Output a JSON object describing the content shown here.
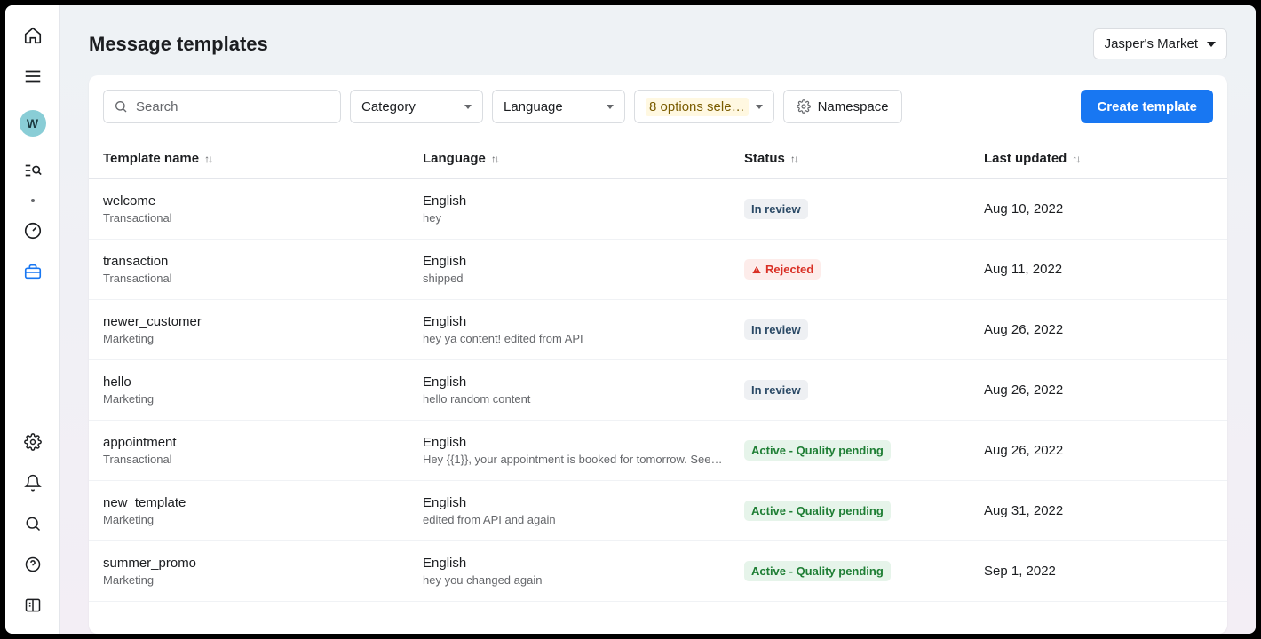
{
  "header": {
    "title": "Message templates",
    "account": "Jasper's Market"
  },
  "sidebar": {
    "avatar_letter": "W"
  },
  "toolbar": {
    "search_placeholder": "Search",
    "category_label": "Category",
    "language_label": "Language",
    "status_filter_label": "8 options sele…",
    "namespace_label": "Namespace",
    "create_label": "Create template"
  },
  "columns": {
    "name": "Template name",
    "language": "Language",
    "status": "Status",
    "updated": "Last updated"
  },
  "status_labels": {
    "in_review": "In review",
    "rejected": "Rejected",
    "active_quality_pending": "Active - Quality pending"
  },
  "rows": [
    {
      "name": "welcome",
      "category": "Transactional",
      "language": "English",
      "preview": "hey",
      "status": "in_review",
      "updated": "Aug 10, 2022"
    },
    {
      "name": "transaction",
      "category": "Transactional",
      "language": "English",
      "preview": "shipped",
      "status": "rejected",
      "updated": "Aug 11, 2022"
    },
    {
      "name": "newer_customer",
      "category": "Marketing",
      "language": "English",
      "preview": "hey ya content! edited from API",
      "status": "in_review",
      "updated": "Aug 26, 2022"
    },
    {
      "name": "hello",
      "category": "Marketing",
      "language": "English",
      "preview": "hello random content",
      "status": "in_review",
      "updated": "Aug 26, 2022"
    },
    {
      "name": "appointment",
      "category": "Transactional",
      "language": "English",
      "preview": "Hey {{1}}, your appointment is booked for tomorrow. See…",
      "status": "active_quality_pending",
      "updated": "Aug 26, 2022"
    },
    {
      "name": "new_template",
      "category": "Marketing",
      "language": "English",
      "preview": "edited from API and again",
      "status": "active_quality_pending",
      "updated": "Aug 31, 2022"
    },
    {
      "name": "summer_promo",
      "category": "Marketing",
      "language": "English",
      "preview": "hey you changed again",
      "status": "active_quality_pending",
      "updated": "Sep 1, 2022"
    }
  ]
}
